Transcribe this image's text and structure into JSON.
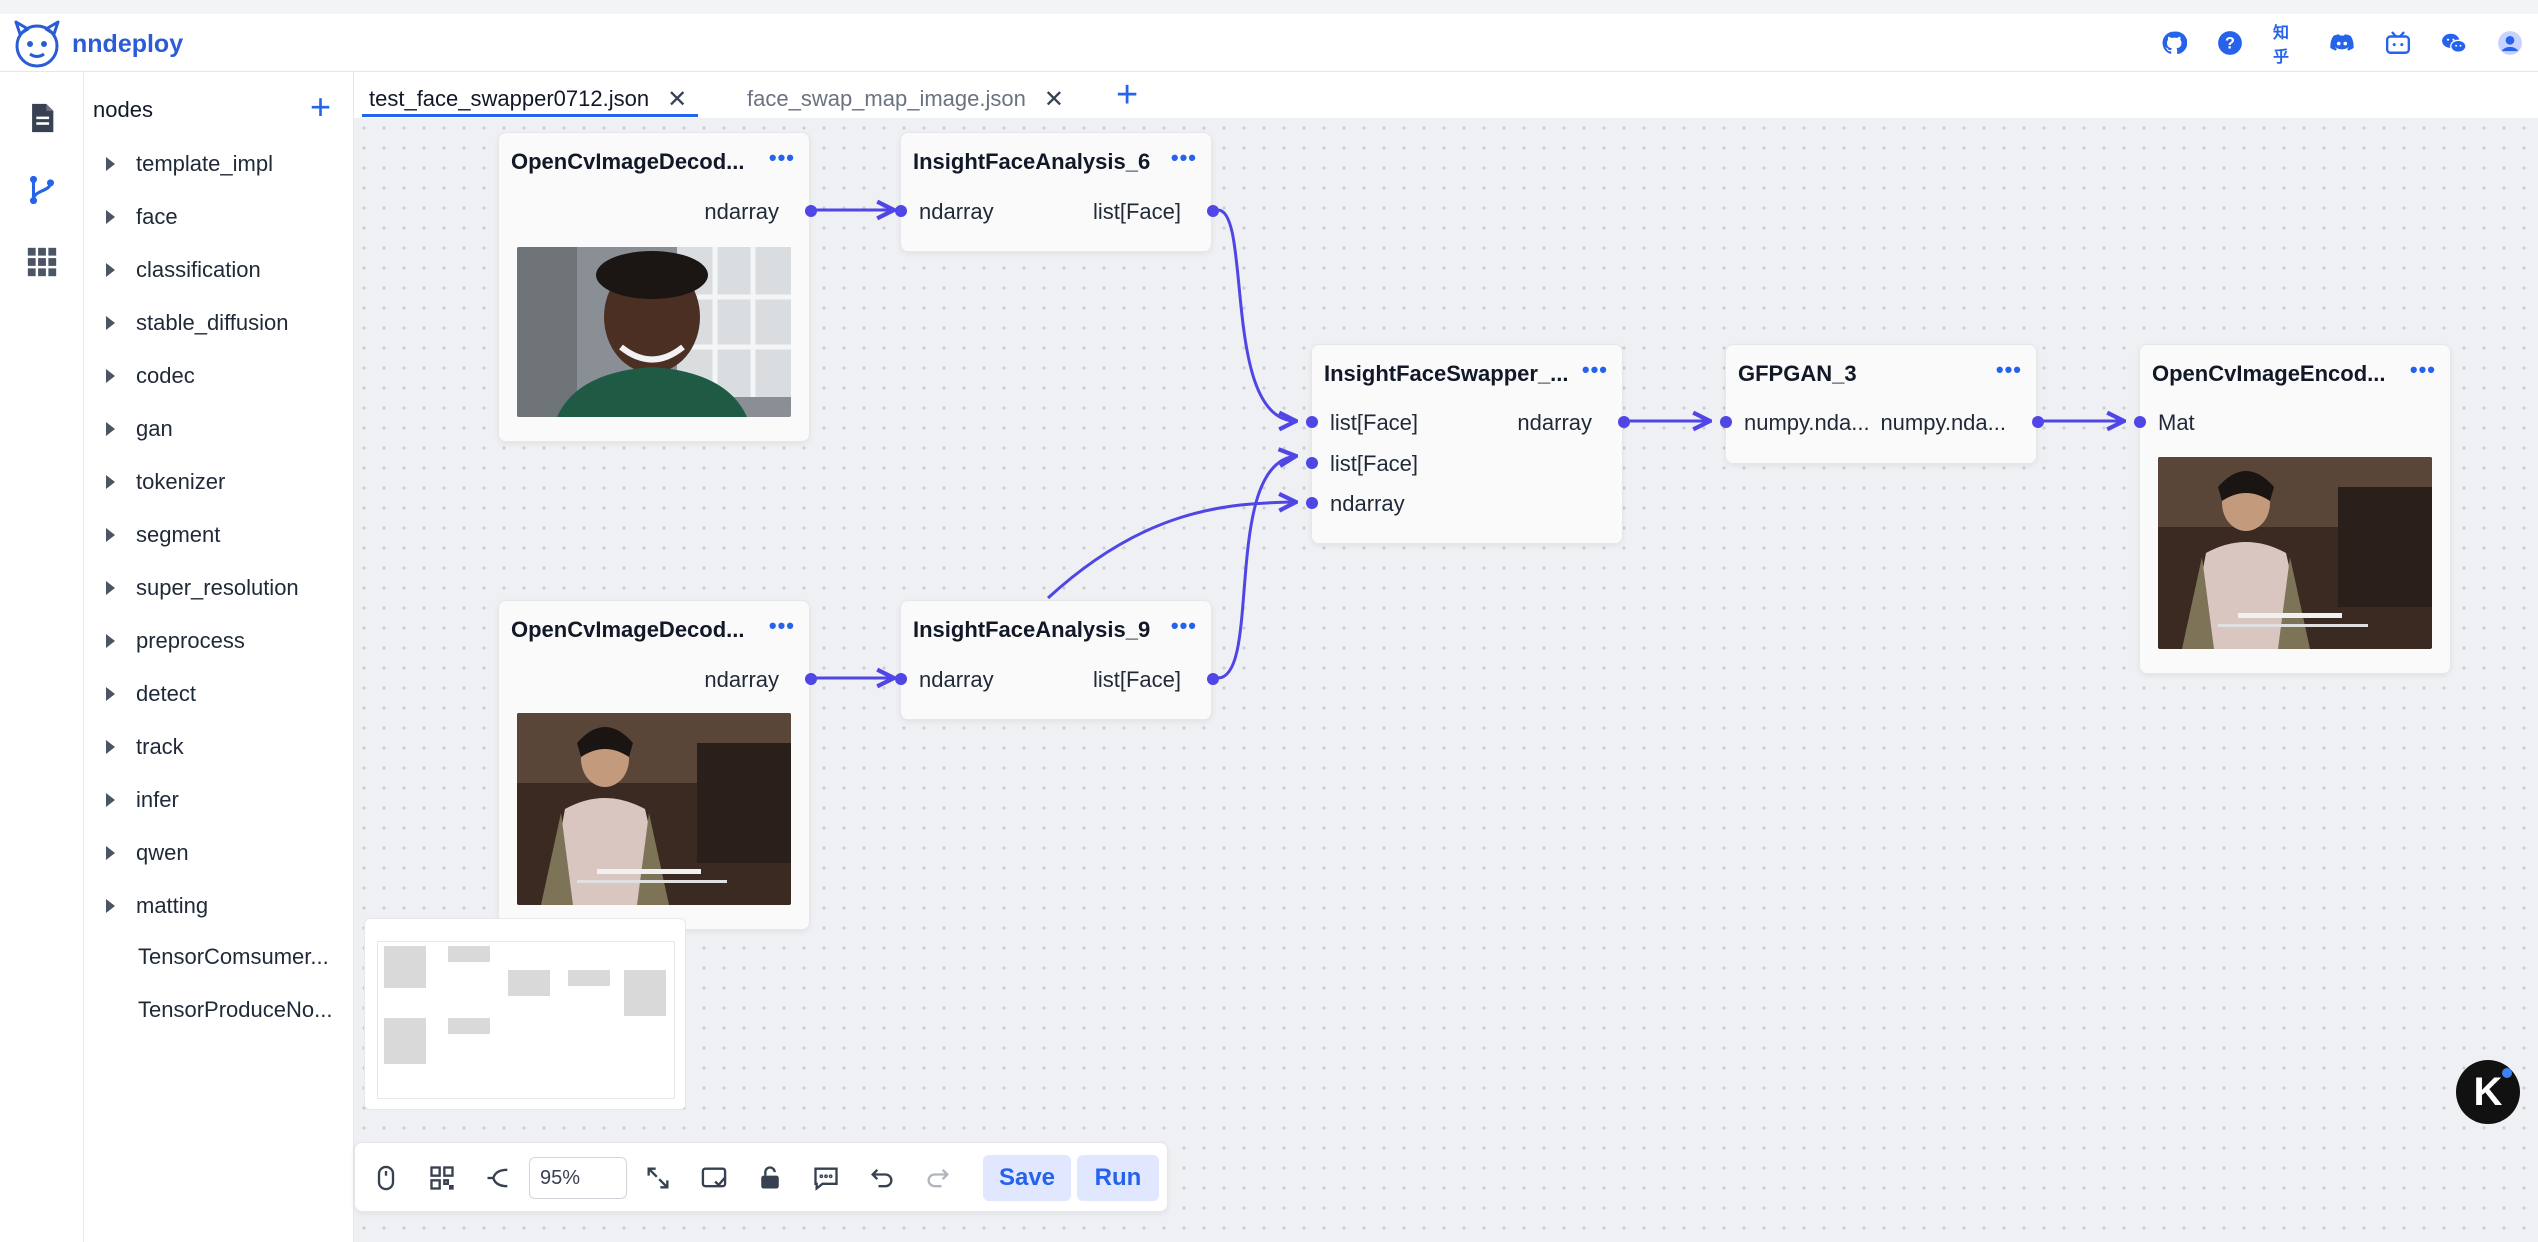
{
  "app": {
    "name": "nndeploy"
  },
  "header": {
    "icons": [
      "github-icon",
      "help-icon",
      "zhihu-icon",
      "discord-icon",
      "bilibili-icon",
      "wechat-icon",
      "user-avatar-icon"
    ],
    "zhihu_label": "知乎"
  },
  "rail": {
    "items": [
      "document-icon",
      "workflow-icon",
      "apps-grid-icon"
    ],
    "active": "workflow-icon"
  },
  "tree": {
    "title": "nodes",
    "add_label": "+",
    "folders": [
      "template_impl",
      "face",
      "classification",
      "stable_diffusion",
      "codec",
      "gan",
      "tokenizer",
      "segment",
      "super_resolution",
      "preprocess",
      "detect",
      "track",
      "infer",
      "qwen",
      "matting"
    ],
    "leaves": [
      "TensorComsumer...",
      "TensorProduceNo..."
    ]
  },
  "tabs": {
    "items": [
      {
        "label": "test_face_swapper0712.json",
        "active": true
      },
      {
        "label": "face_swap_map_image.json",
        "active": false
      }
    ],
    "close_glyph": "✕",
    "add_label": "+"
  },
  "nodes": {
    "decode1": {
      "title": "OpenCvImageDecod...",
      "output": "ndarray",
      "image": "smiling-young-man-portrait"
    },
    "analysis6": {
      "title": "InsightFaceAnalysis_6",
      "input": "ndarray",
      "output": "list[Face]"
    },
    "swapper": {
      "title": "InsightFaceSwapper_...",
      "inputs": [
        "list[Face]",
        "list[Face]",
        "ndarray"
      ],
      "output": "ndarray"
    },
    "gfpgan": {
      "title": "GFPGAN_3",
      "input": "numpy.nda...",
      "output": "numpy.nda..."
    },
    "encode": {
      "title": "OpenCvImageEncod...",
      "input": "Mat",
      "image": "movie-still-subtitled"
    },
    "decode2": {
      "title": "OpenCvImageDecod...",
      "output": "ndarray",
      "image": "movie-still-subtitled"
    },
    "analysis9": {
      "title": "InsightFaceAnalysis_9",
      "input": "ndarray",
      "output": "list[Face]"
    },
    "menu_glyph": "•••"
  },
  "toolbar": {
    "zoom": "95%",
    "save_label": "Save",
    "run_label": "Run",
    "tools": [
      "mouse-icon",
      "qrcode-icon",
      "auto-layout-icon",
      "fit-view-icon",
      "minimap-toggle-icon",
      "lock-icon",
      "comment-icon",
      "undo-icon",
      "redo-icon"
    ]
  },
  "badge": {
    "label": "K"
  },
  "colors": {
    "accent": "#2563eb",
    "edge": "#4f46e5",
    "canvas": "#eef0f3"
  }
}
